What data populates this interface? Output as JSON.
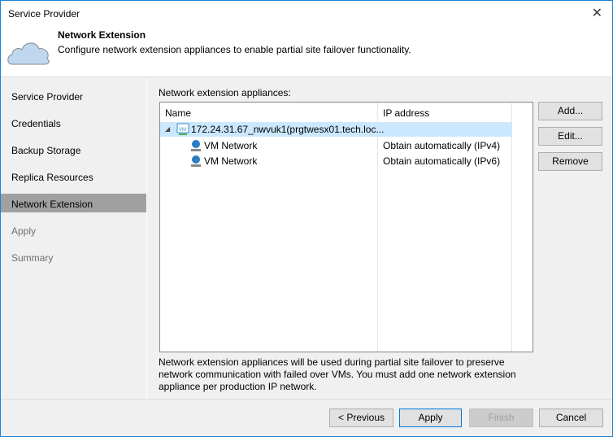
{
  "window": {
    "title": "Service Provider",
    "close": "✕"
  },
  "header": {
    "title": "Network Extension",
    "description": "Configure network extension appliances to enable partial site failover functionality."
  },
  "nav": [
    {
      "label": "Service Provider"
    },
    {
      "label": "Credentials"
    },
    {
      "label": "Backup Storage"
    },
    {
      "label": "Replica Resources"
    },
    {
      "label": "Network Extension"
    },
    {
      "label": "Apply"
    },
    {
      "label": "Summary"
    }
  ],
  "main": {
    "list_label": "Network extension appliances:",
    "columns": [
      "Name",
      "IP address"
    ],
    "appliance": {
      "name": "172.24.31.67_nwvuk1(prgtwesx01.tech.loc...",
      "ip": ""
    },
    "networks": [
      {
        "name": "VM Network",
        "ip": "Obtain automatically (IPv4)"
      },
      {
        "name": "VM Network",
        "ip": "Obtain automatically (IPv6)"
      }
    ],
    "buttons": {
      "add": "Add...",
      "edit": "Edit...",
      "remove": "Remove"
    },
    "note": "Network extension appliances will be used during partial site failover to preserve network communication with failed over VMs. You must add one network extension appliance per production IP network."
  },
  "footer": {
    "previous": "< Previous",
    "apply": "Apply",
    "finish": "Finish",
    "cancel": "Cancel"
  }
}
